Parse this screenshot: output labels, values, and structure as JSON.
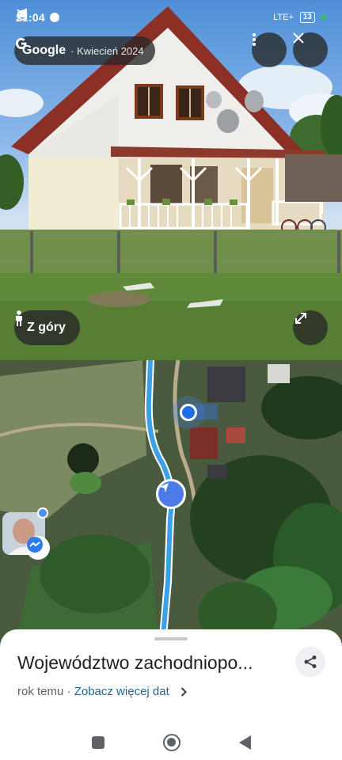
{
  "status_bar": {
    "time": "21:04",
    "network": "LTE+",
    "battery": "13",
    "icons": [
      "messenger-icon",
      "location-arrow-icon",
      "alarm-off-icon",
      "signal-icon",
      "battery-icon"
    ]
  },
  "streetview": {
    "brand": "Google",
    "date": "Kwiecień 2024",
    "more_icon": "more-vertical-icon",
    "close_icon": "close-icon",
    "view_toggle_label": "Z góry",
    "view_toggle_icon": "pegman-icon",
    "expand_icon": "expand-icon"
  },
  "map": {
    "route_color": "#3aa0e8",
    "nav_color": "#4a7be6",
    "location_color": "#1f6ee8"
  },
  "chat_head": {
    "badge_icon": "messenger-icon"
  },
  "place": {
    "title": "Województwo zachodniopo...",
    "time_ago": "rok temu",
    "separator": " · ",
    "more_dates_link": "Zobacz więcej dat",
    "share_icon": "share-icon"
  },
  "system_nav": {
    "recents_icon": "recents-icon",
    "home_icon": "home-icon",
    "back_icon": "back-icon"
  }
}
